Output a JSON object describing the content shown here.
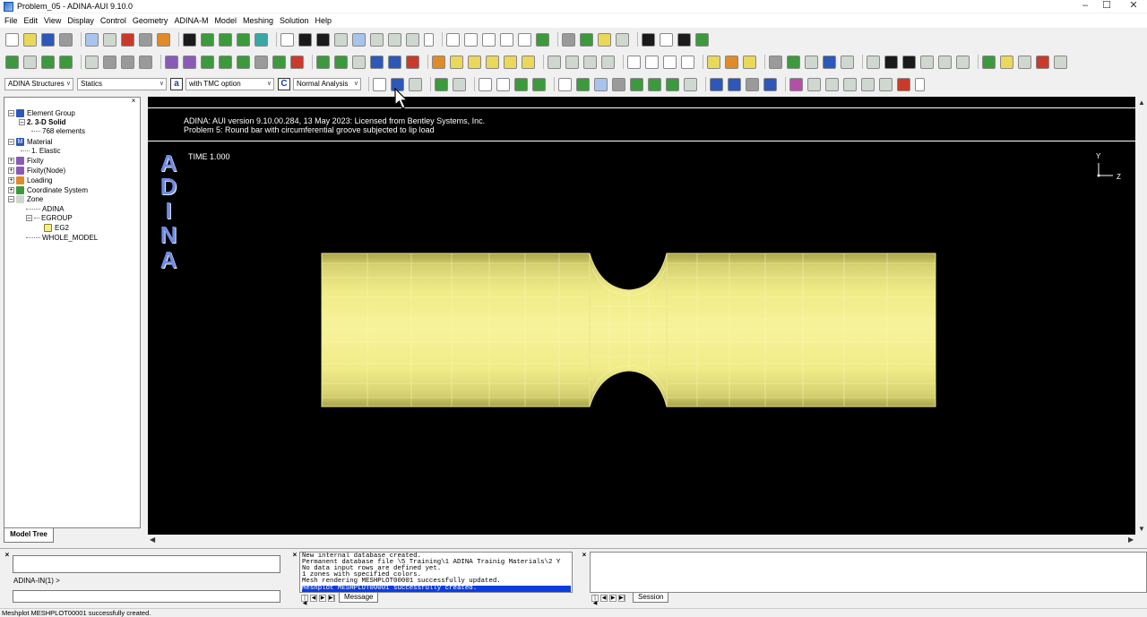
{
  "window": {
    "title": "Problem_05 - ADINA-AUI 9.10.0",
    "minimize": "–",
    "maximize": "☐",
    "close": "✕"
  },
  "menu": [
    "File",
    "Edit",
    "View",
    "Display",
    "Control",
    "Geometry",
    "ADINA-M",
    "Model",
    "Meshing",
    "Solution",
    "Help"
  ],
  "toolbar3": {
    "program": "ADINA Structures",
    "analysis": "Statics",
    "tmc_letter": "a",
    "tmc": "with TMC option",
    "c_letter": "C",
    "mode": "Normal Analysis"
  },
  "tree": {
    "items": [
      {
        "label": "Element Group",
        "bold": false
      },
      {
        "label": "2. 3-D Solid",
        "bold": true
      },
      {
        "label": "768 elements",
        "bold": false
      },
      {
        "label": "Material",
        "bold": false
      },
      {
        "label": "1. Elastic",
        "bold": false
      },
      {
        "label": "Fixity",
        "bold": false
      },
      {
        "label": "Fixity(Node)",
        "bold": false
      },
      {
        "label": "Loading",
        "bold": false
      },
      {
        "label": "Coordinate System",
        "bold": false
      },
      {
        "label": "Zone",
        "bold": false
      },
      {
        "label": "ADINA",
        "bold": false
      },
      {
        "label": "EGROUP",
        "bold": false
      },
      {
        "label": "EG2",
        "bold": false
      },
      {
        "label": "WHOLE_MODEL",
        "bold": false
      }
    ],
    "tab": "Model Tree"
  },
  "viewport": {
    "header_line1": "ADINA: AUI version 9.10.00.284, 13 May 2023: Licensed from Bentley Systems, Inc.",
    "header_line2": "Problem 5: Round bar with circumferential groove subjected to lip load",
    "logo_letters": [
      "A",
      "D",
      "I",
      "N",
      "A"
    ],
    "time": "TIME 1.000",
    "axis_y": "Y",
    "axis_z": "Z",
    "mesh_color": "#f4f088",
    "mesh_color_dark": "#a8a448"
  },
  "command": {
    "prompt": "ADINA-IN(1) >"
  },
  "messages": {
    "lines": [
      " New internal database created.",
      "Permanent database file \\5 Training\\1 ADINA Trainig Materials\\2 Y",
      "No data input rows are defined yet.",
      "1 zones with specified colors.",
      "Mesh rendering MESHPLOT00001 successfully updated."
    ],
    "highlighted": " Meshplot MESHPLOT00001 successfully created.",
    "tab": "Message"
  },
  "session": {
    "tab": "Session"
  },
  "status": "Meshplot MESHPLOT00001 successfully created."
}
